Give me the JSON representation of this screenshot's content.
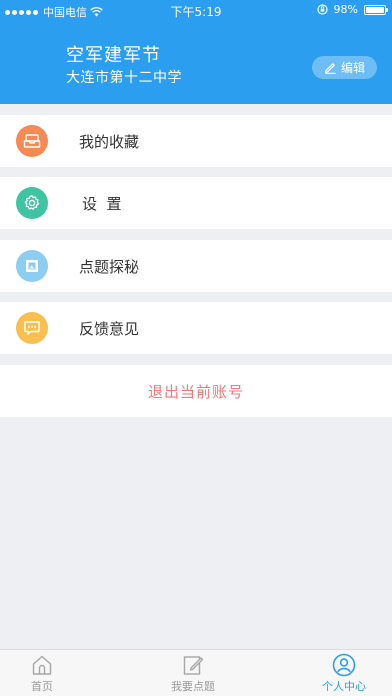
{
  "status_bar": {
    "carrier": "中国电信",
    "time": "下午5:19",
    "battery": "98%",
    "battery_level": 0.98
  },
  "profile": {
    "name": "空军建军节",
    "school": "大连市第十二中学",
    "edit_label": "编辑"
  },
  "menu": [
    {
      "label": "我的收藏",
      "icon": "inbox-tray-icon",
      "color": "#f58a55"
    },
    {
      "label": "设  置",
      "icon": "gear-icon",
      "color": "#3fc4a3"
    },
    {
      "label": "点题探秘",
      "icon": "picture-frame-icon",
      "color": "#8ccdf0"
    },
    {
      "label": "反馈意见",
      "icon": "chat-bubble-icon",
      "color": "#f9c04f"
    }
  ],
  "logout_label": "退出当前账号",
  "tabbar": {
    "tabs": [
      {
        "label": "首页",
        "icon": "home-icon"
      },
      {
        "label": "我要点题",
        "icon": "edit-note-icon"
      },
      {
        "label": "个人中心",
        "icon": "user-icon"
      }
    ],
    "active_index": 2
  },
  "colors": {
    "accent": "#2c9ef0",
    "logout": "#f07a7a",
    "background": "#eeeff2"
  }
}
